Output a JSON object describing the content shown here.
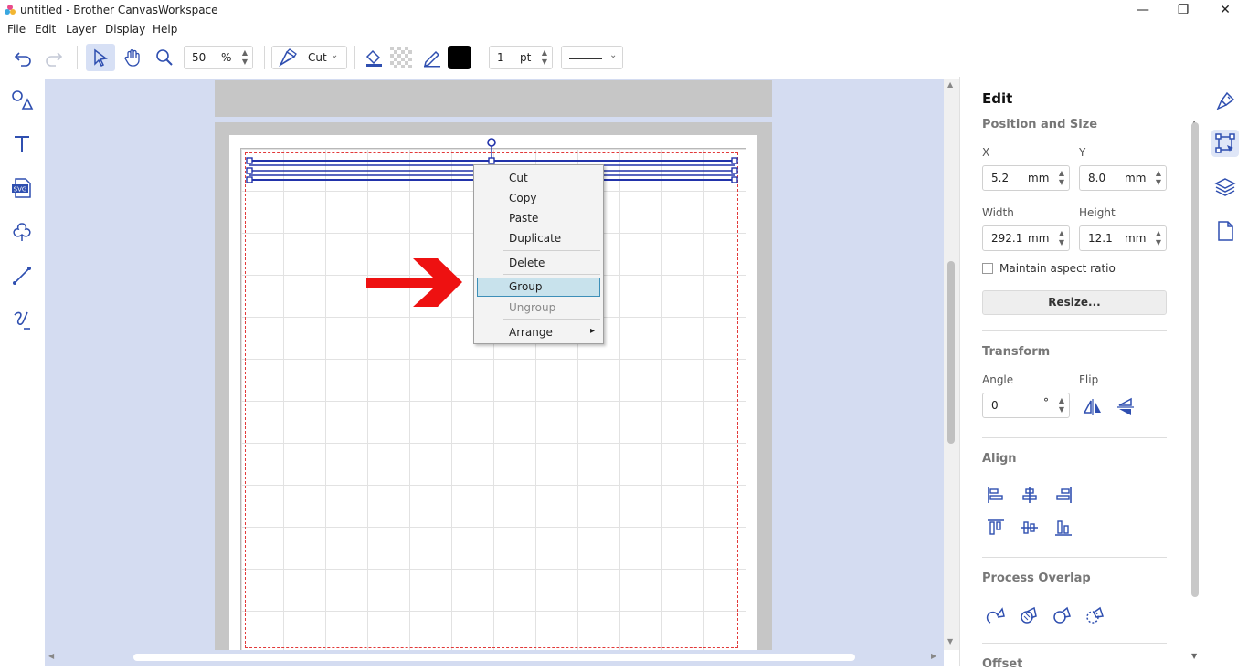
{
  "window": {
    "title": "untitled - Brother CanvasWorkspace",
    "minimize": "—",
    "restore": "❐",
    "close": "✕"
  },
  "menu": [
    "File",
    "Edit",
    "Layer",
    "Display",
    "Help"
  ],
  "toolbar": {
    "zoom_value": "50",
    "zoom_unit": "%",
    "mode_label": "Cut",
    "line_width_value": "1",
    "line_width_unit": "pt",
    "fill_color": "#000000"
  },
  "context_menu": {
    "items": [
      "Cut",
      "Copy",
      "Paste",
      "Duplicate",
      "Delete",
      "Group",
      "Ungroup",
      "Arrange"
    ],
    "highlighted": "Group",
    "disabled": [
      "Ungroup"
    ],
    "submenu_arrow": "▸"
  },
  "panel": {
    "title": "Edit",
    "position_size": {
      "heading": "Position and Size",
      "x_label": "X",
      "x_value": "5.2",
      "x_unit": "mm",
      "y_label": "Y",
      "y_value": "8.0",
      "y_unit": "mm",
      "width_label": "Width",
      "width_value": "292.1",
      "width_unit": "mm",
      "height_label": "Height",
      "height_value": "12.1",
      "height_unit": "mm",
      "aspect_label": "Maintain aspect ratio",
      "resize_button": "Resize..."
    },
    "transform": {
      "heading": "Transform",
      "angle_label": "Angle",
      "angle_value": "0",
      "angle_unit": "°",
      "flip_label": "Flip"
    },
    "align": {
      "heading": "Align"
    },
    "process_overlap": {
      "heading": "Process Overlap"
    },
    "offset": {
      "heading": "Offset"
    }
  },
  "colors": {
    "accent": "#2f4fb0",
    "canvas_bg": "#d4dcf1",
    "arrow": "#ee1111",
    "selection": "#2233aa"
  }
}
